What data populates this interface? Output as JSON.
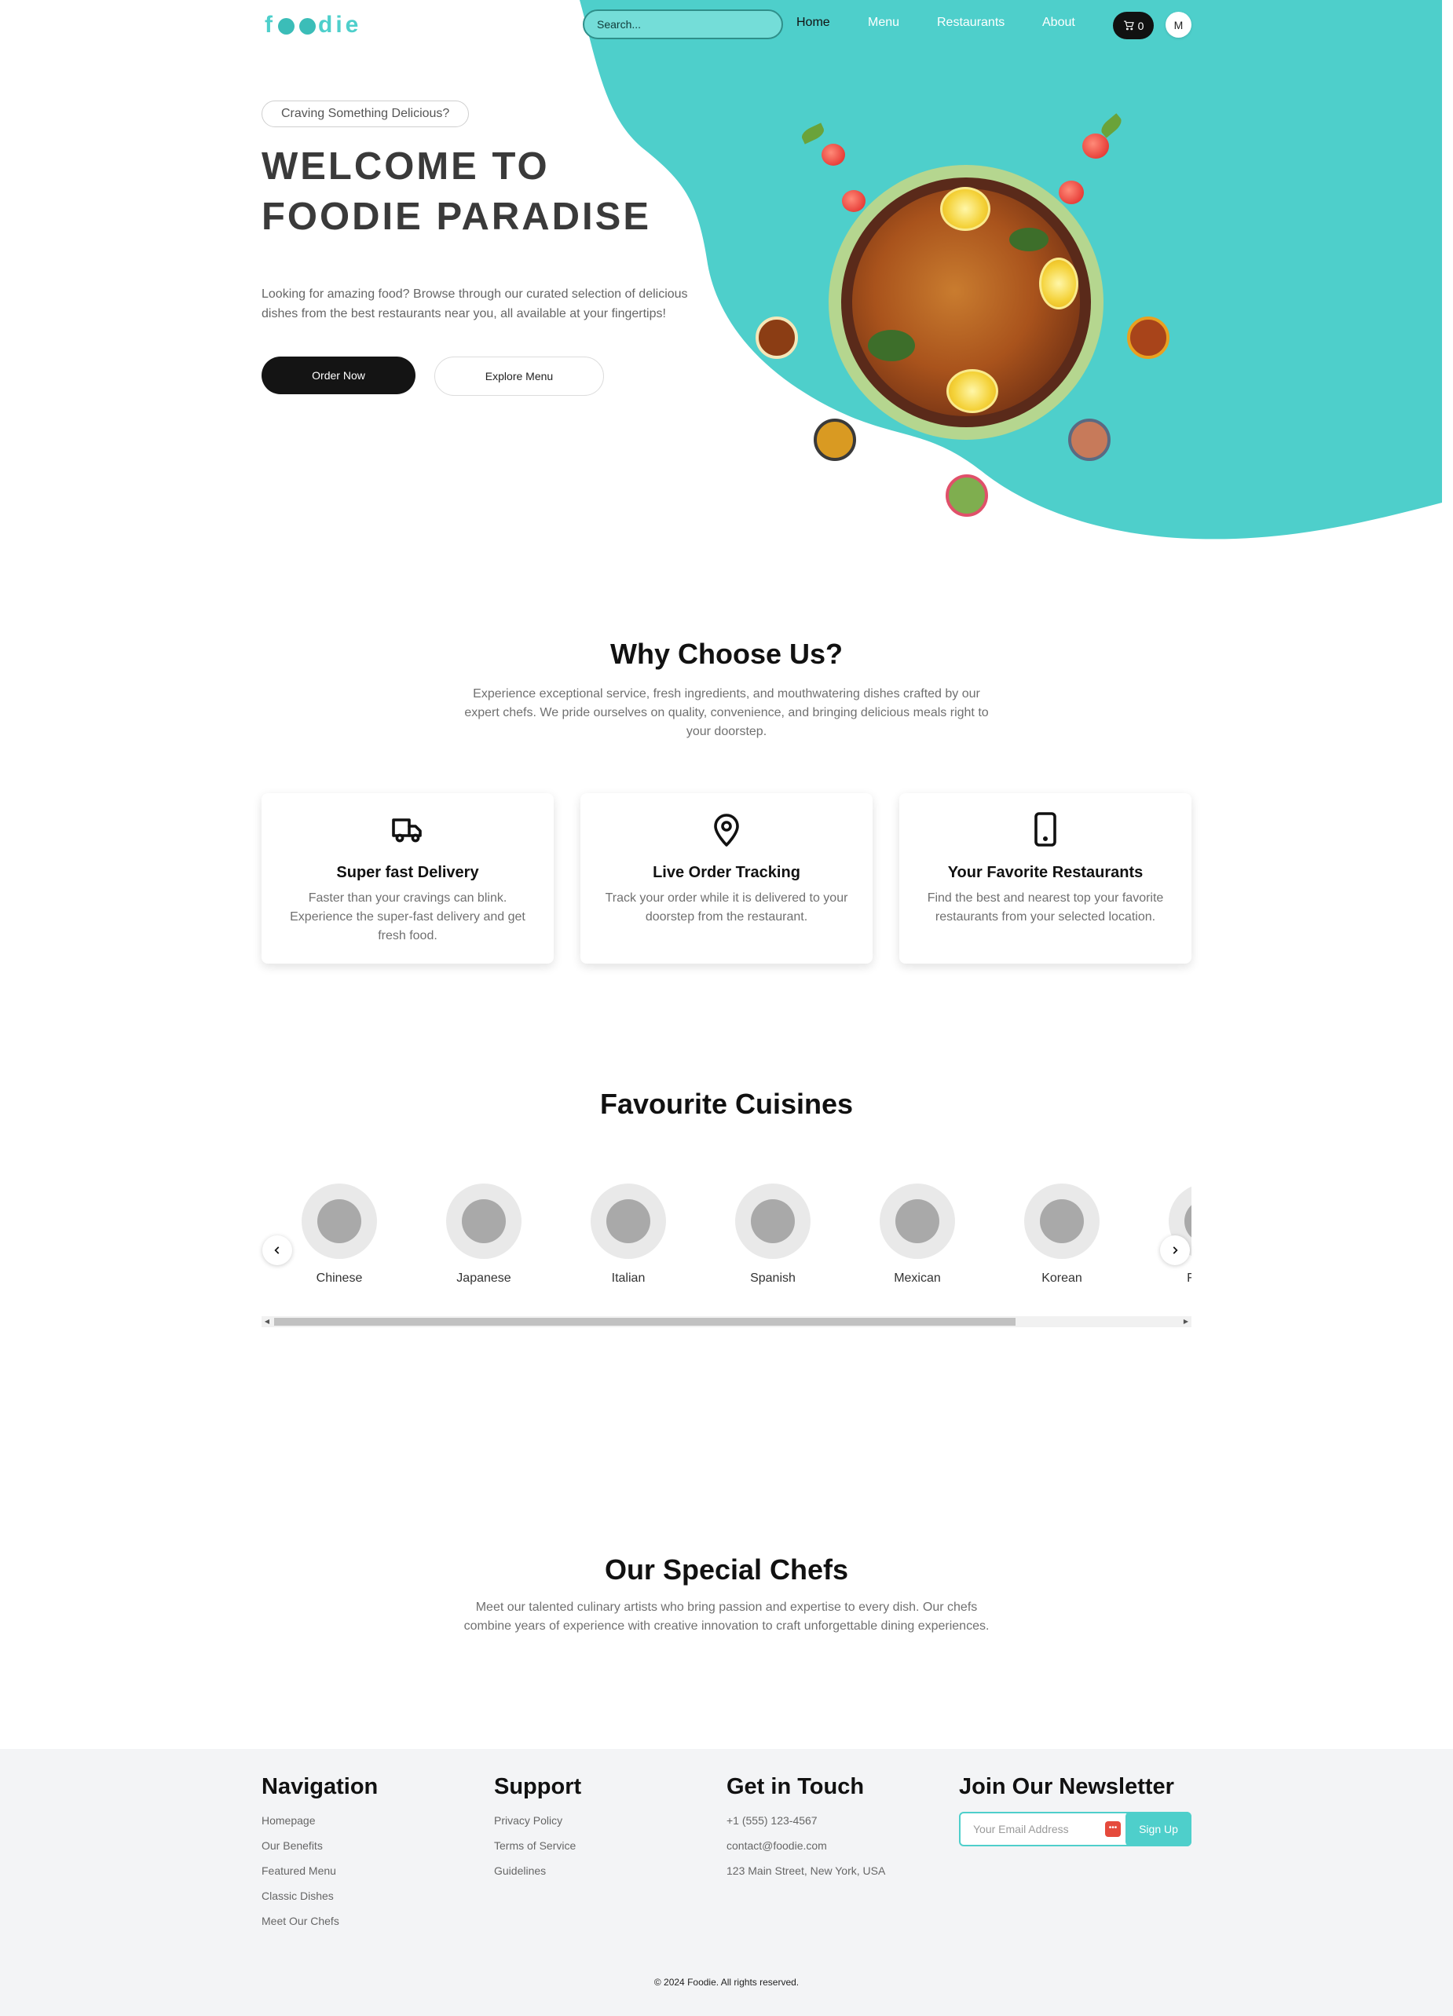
{
  "header": {
    "logo": "foodie",
    "search_placeholder": "Search...",
    "nav": [
      "Home",
      "Menu",
      "Restaurants",
      "About"
    ],
    "cart_count": "0",
    "avatar_initial": "M"
  },
  "hero": {
    "pill": "Craving Something Delicious?",
    "title_line1": "WELCOME TO",
    "title_line2": "FOODIE PARADISE",
    "description": "Looking for amazing food? Browse through our curated selection of delicious dishes from the best restaurants near you, all available at your fingertips!",
    "order_button": "Order Now",
    "explore_button": "Explore Menu"
  },
  "why": {
    "title": "Why Choose Us?",
    "description": "Experience exceptional service, fresh ingredients, and mouthwatering dishes crafted by our expert chefs. We pride ourselves on quality, convenience, and bringing delicious meals right to your doorstep.",
    "cards": [
      {
        "title": "Super fast Delivery",
        "text": "Faster than your cravings can blink. Experience the super-fast delivery and get fresh food.",
        "icon": "truck-icon"
      },
      {
        "title": "Live Order Tracking",
        "text": "Track your order while it is delivered to your doorstep from the restaurant.",
        "icon": "map-pin-icon"
      },
      {
        "title": "Your Favorite Restaurants",
        "text": "Find the best and nearest top your favorite restaurants from your selected location.",
        "icon": "smartphone-icon"
      }
    ]
  },
  "cuisines": {
    "title": "Favourite Cuisines",
    "items": [
      "Chinese",
      "Japanese",
      "Italian",
      "Spanish",
      "Mexican",
      "Korean",
      "French"
    ]
  },
  "chefs": {
    "title": "Our Special Chefs",
    "description": "Meet our talented culinary artists who bring passion and expertise to every dish. Our chefs combine years of experience with creative innovation to craft unforgettable dining experiences."
  },
  "footer": {
    "navigation": {
      "title": "Navigation",
      "links": [
        "Homepage",
        "Our Benefits",
        "Featured Menu",
        "Classic Dishes",
        "Meet Our Chefs"
      ]
    },
    "support": {
      "title": "Support",
      "links": [
        "Privacy Policy",
        "Terms of Service",
        "Guidelines"
      ]
    },
    "contact": {
      "title": "Get in Touch",
      "lines": [
        "+1 (555) 123-4567",
        "contact@foodie.com",
        "123 Main Street, New York, USA"
      ]
    },
    "newsletter": {
      "title": "Join Our Newsletter",
      "placeholder": "Your Email Address",
      "button": "Sign Up"
    },
    "copyright": "© 2024 Foodie. All rights reserved."
  },
  "colors": {
    "accent": "#4ecfcb",
    "dark": "#141414",
    "footer_bg": "#f3f4f6"
  }
}
